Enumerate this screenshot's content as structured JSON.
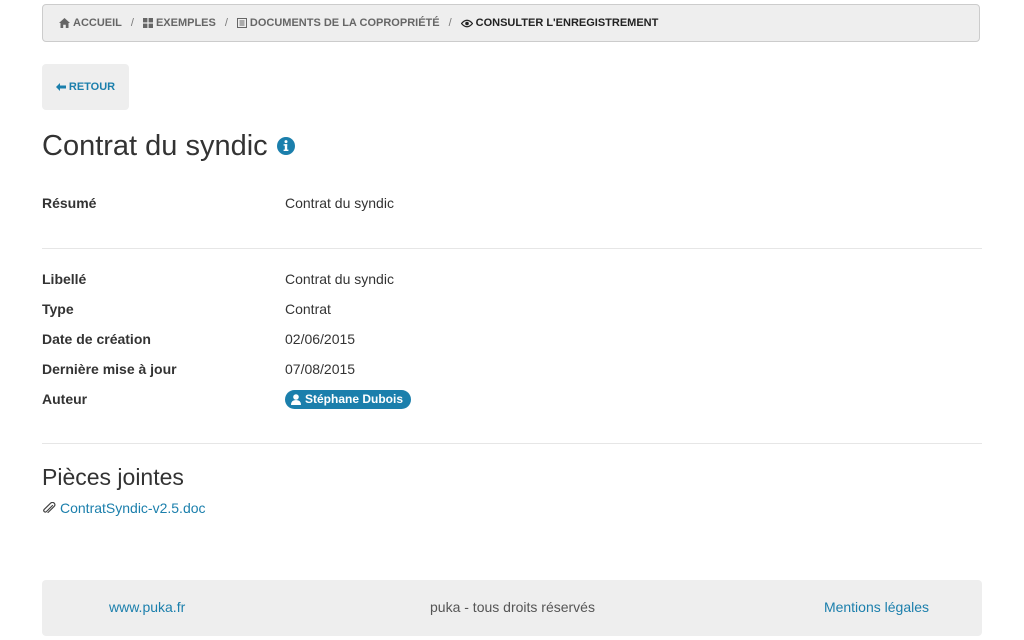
{
  "breadcrumb": {
    "items": [
      {
        "label": "Accueil",
        "icon": "home-icon"
      },
      {
        "label": "Exemples",
        "icon": "grid-icon"
      },
      {
        "label": "Documents de la copropriété",
        "icon": "list-icon"
      },
      {
        "label": "Consulter l'enregistrement",
        "icon": "eye-icon"
      }
    ],
    "separator": "/"
  },
  "back_button": {
    "label": "Retour",
    "icon": "arrow-left-icon"
  },
  "title": "Contrat du syndic",
  "summary": {
    "label": "Résumé",
    "value": "Contrat du syndic"
  },
  "fields": [
    {
      "label": "Libellé",
      "value": "Contrat du syndic"
    },
    {
      "label": "Type",
      "value": "Contrat"
    },
    {
      "label": "Date de création",
      "value": "02/06/2015"
    },
    {
      "label": "Dernière mise à jour",
      "value": "07/08/2015"
    },
    {
      "label": "Auteur",
      "value": "Stéphane Dubois"
    }
  ],
  "attachments": {
    "title": "Pièces jointes",
    "files": [
      {
        "name": "ContratSyndic-v2.5.doc",
        "icon": "paperclip-icon"
      }
    ]
  },
  "footer": {
    "website": "www.puka.fr",
    "copyright": "puka - tous droits réservés",
    "legal": "Mentions légales"
  },
  "colors": {
    "accent": "#1b7fac",
    "panel": "#eeeeee",
    "text": "#333333"
  }
}
